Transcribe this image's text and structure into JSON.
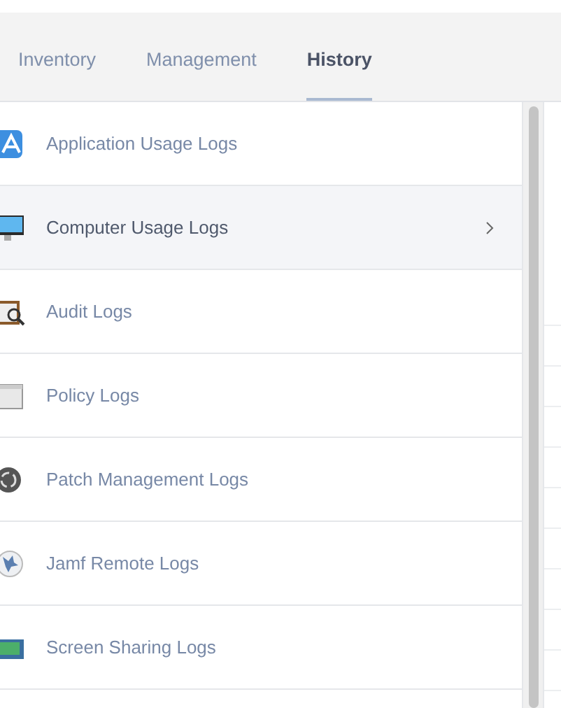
{
  "tabs": [
    {
      "label": "Inventory",
      "selected": false
    },
    {
      "label": "Management",
      "selected": false
    },
    {
      "label": "History",
      "selected": true
    }
  ],
  "log_list": [
    {
      "label": "Application Usage Logs",
      "selected": false
    },
    {
      "label": "Computer Usage Logs",
      "selected": true
    },
    {
      "label": "Audit Logs",
      "selected": false
    },
    {
      "label": "Policy Logs",
      "selected": false
    },
    {
      "label": "Patch Management Logs",
      "selected": false
    },
    {
      "label": "Jamf Remote Logs",
      "selected": false
    },
    {
      "label": "Screen Sharing Logs",
      "selected": false
    }
  ]
}
